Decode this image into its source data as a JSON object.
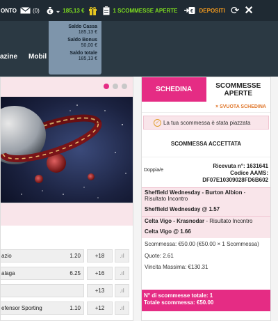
{
  "topbar": {
    "account_label": "ONTO",
    "messages_count": "(0)",
    "balance": "185,13 €",
    "open_bets_label": "1 SCOMMESSE APERTE",
    "deposit_label": "DEPOSITI",
    "accent_green": "#7ddc1f",
    "accent_orange": "#f39a1e"
  },
  "balance_dropdown": {
    "cash_label": "Saldo Cassa",
    "cash_value": "185,13 €",
    "bonus_label": "Saldo Bonus",
    "bonus_value": "50,00 €",
    "total_label": "Saldo totale",
    "total_value": "185,13 €"
  },
  "nav": {
    "items": [
      "azine",
      "Mobil"
    ]
  },
  "odds_rows": [
    {
      "name": "azio",
      "odds": "1.20",
      "more": "+18"
    },
    {
      "name": "alaga",
      "odds": "6.25",
      "more": "+16"
    },
    {
      "name": "",
      "odds": "",
      "more": "+13"
    },
    {
      "name": "efensor Sporting",
      "odds": "1.10",
      "more": "+12"
    }
  ],
  "betslip": {
    "tab_active": "SCHEDINA",
    "tab_other": "SCOMMESSE APERTE",
    "clear_label": "× SVUOTA SCHEDINA",
    "placed_msg": "La tua scommessa è stata piazzata",
    "accepted_title": "SCOMMESSA ACCETTATA",
    "bet_type": "Doppia/e",
    "receipt_label": "Ricevuta n°: 1631641",
    "code_label": "Codice AAMS:",
    "code_value": "DF07E10309028FD6B602",
    "events": [
      {
        "teams": "Sheffield Wednesday - Burton Albion",
        "market": " - Risultato Incontro",
        "pick": "Sheffield Wednesday @ 1.57"
      },
      {
        "teams": "Celta Vigo - Krasnodar",
        "market": " - Risultato Incontro",
        "pick": "Celta Vigo @ 1.66"
      }
    ],
    "stake": "Scommessa: €50.00 (€50.00 × 1 Scommessa)",
    "odds": "Quote: 2.61",
    "max_win": "Vincita Massima: €130.31",
    "total_bets": "N° di scommesse totale: 1",
    "total_stake": "Totale scommessa: €50.00",
    "accent_pink": "#e52c84"
  }
}
